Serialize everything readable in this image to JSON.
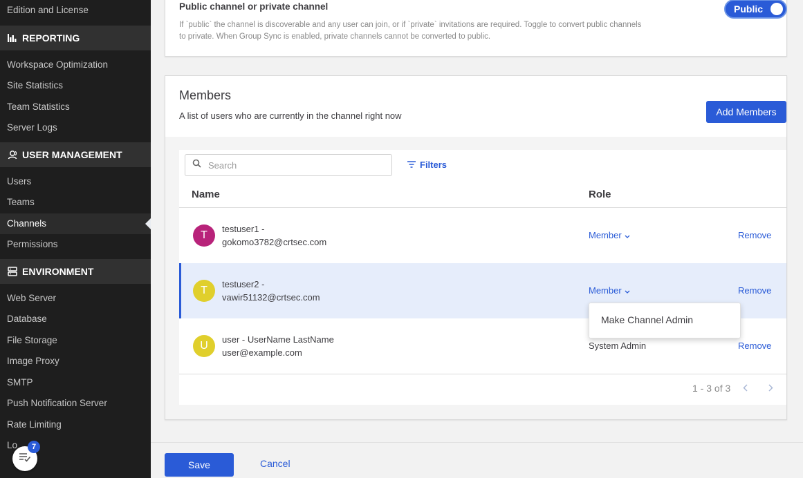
{
  "sidebar": {
    "top_item": "Edition and License",
    "sections": [
      {
        "title": "REPORTING",
        "icon": "bar-chart-icon",
        "items": [
          "Workspace Optimization",
          "Site Statistics",
          "Team Statistics",
          "Server Logs"
        ]
      },
      {
        "title": "USER MANAGEMENT",
        "icon": "users-icon",
        "items": [
          "Users",
          "Teams",
          "Channels",
          "Permissions"
        ]
      },
      {
        "title": "ENVIRONMENT",
        "icon": "server-icon",
        "items": [
          "Web Server",
          "Database",
          "File Storage",
          "Image Proxy",
          "SMTP",
          "Push Notification Server",
          "Rate Limiting",
          "Lo"
        ]
      }
    ],
    "active_item": "Channels",
    "chat_badge_count": "7"
  },
  "public_setting": {
    "title": "Public channel or private channel",
    "description": "If `public` the channel is discoverable and any user can join, or if `private` invitations are required. Toggle to convert public channels to private. When Group Sync is enabled, private channels cannot be converted to public.",
    "toggle_label": "Public"
  },
  "members": {
    "title": "Members",
    "subtitle": "A list of users who are currently in the channel right now",
    "add_button": "Add Members",
    "search_placeholder": "Search",
    "filters_label": "Filters",
    "col_name": "Name",
    "col_role": "Role",
    "rows": [
      {
        "initial": "T",
        "color": "#b8237a",
        "line1": "testuser1 -",
        "line2": "gokomo3782@crtsec.com",
        "role": "Member",
        "remove": "Remove"
      },
      {
        "initial": "T",
        "color": "#e0cf2c",
        "line1": "testuser2 -",
        "line2": "vawir51132@crtsec.com",
        "role": "Member",
        "remove": "Remove"
      },
      {
        "initial": "U",
        "color": "#e0cf2c",
        "line1": "user - UserName LastName",
        "line2": "user@example.com",
        "role": "System Admin",
        "remove": "Remove"
      }
    ],
    "dropdown_option": "Make Channel Admin",
    "pagination": "1 - 3 of 3"
  },
  "footer": {
    "save": "Save",
    "cancel": "Cancel"
  }
}
